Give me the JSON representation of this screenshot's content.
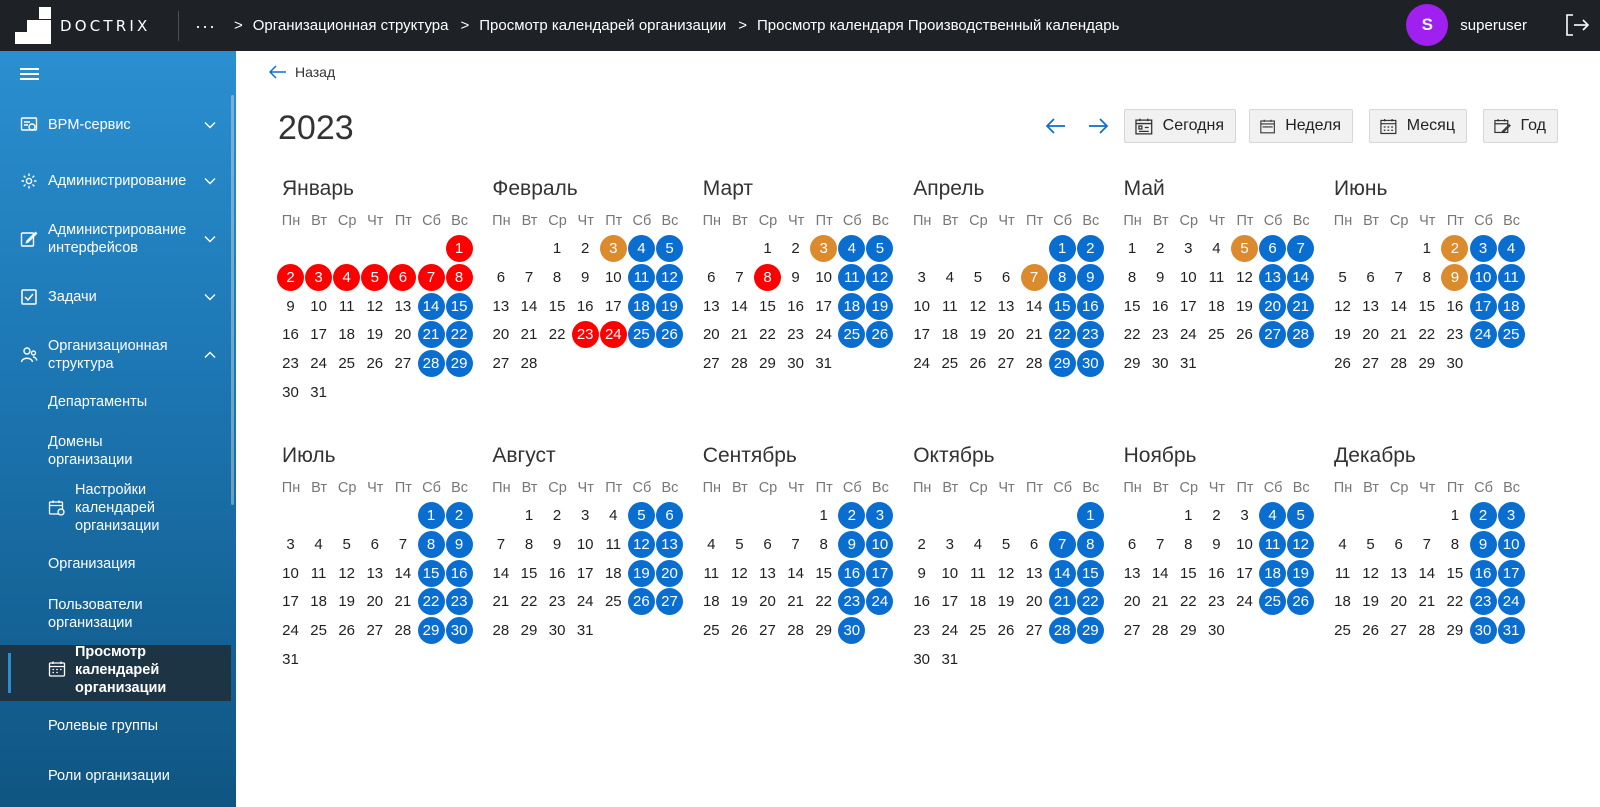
{
  "app": {
    "logo_text": "DOCTRIX",
    "more": "···",
    "breadcrumbs": [
      "Организационная структура",
      "Просмотр календарей организации",
      "Просмотр календаря Производственный календарь"
    ],
    "user_initial": "S",
    "username": "superuser"
  },
  "sidebar": {
    "items": [
      {
        "label": "BPM-сервис",
        "icon": "bpm-icon"
      },
      {
        "label": "Администрирование",
        "icon": "gear-icon"
      },
      {
        "label": "Администрирование интерфейсов",
        "icon": "edit-icon"
      },
      {
        "label": "Задачи",
        "icon": "checkbox-icon"
      },
      {
        "label": "Организационная структура",
        "icon": "org-icon"
      }
    ],
    "subitems": [
      "Департаменты",
      "Домены организации",
      "Настройки календарей организации",
      "Организация",
      "Пользователи организации",
      "Просмотр календарей организации",
      "Ролевые группы",
      "Роли организации"
    ]
  },
  "main": {
    "back_label": "Назад",
    "year": "2023",
    "view_buttons": [
      "Сегодня",
      "Неделя",
      "Месяц",
      "Год"
    ],
    "weekdays": [
      "Пн",
      "Вт",
      "Ср",
      "Чт",
      "Пт",
      "Сб",
      "Вс"
    ],
    "months": [
      "Январь",
      "Февраль",
      "Март",
      "Апрель",
      "Май",
      "Июнь",
      "Июль",
      "Август",
      "Сентябрь",
      "Октябрь",
      "Ноябрь",
      "Декабрь"
    ],
    "holidays": {
      "1": [
        1,
        2,
        3,
        4,
        5,
        6,
        7,
        8
      ],
      "2": [
        23,
        24
      ],
      "3": [
        8
      ]
    },
    "short_days": {
      "2": [
        3
      ],
      "3": [
        3
      ],
      "4": [
        7
      ],
      "5": [
        5
      ],
      "6": [
        2,
        9
      ]
    },
    "colors": {
      "weekend": "#0a6ed1",
      "holiday": "#ff0000",
      "short_day": "#db8b2e",
      "accent": "#2a8fd0",
      "avatar": "#a020f0"
    }
  }
}
